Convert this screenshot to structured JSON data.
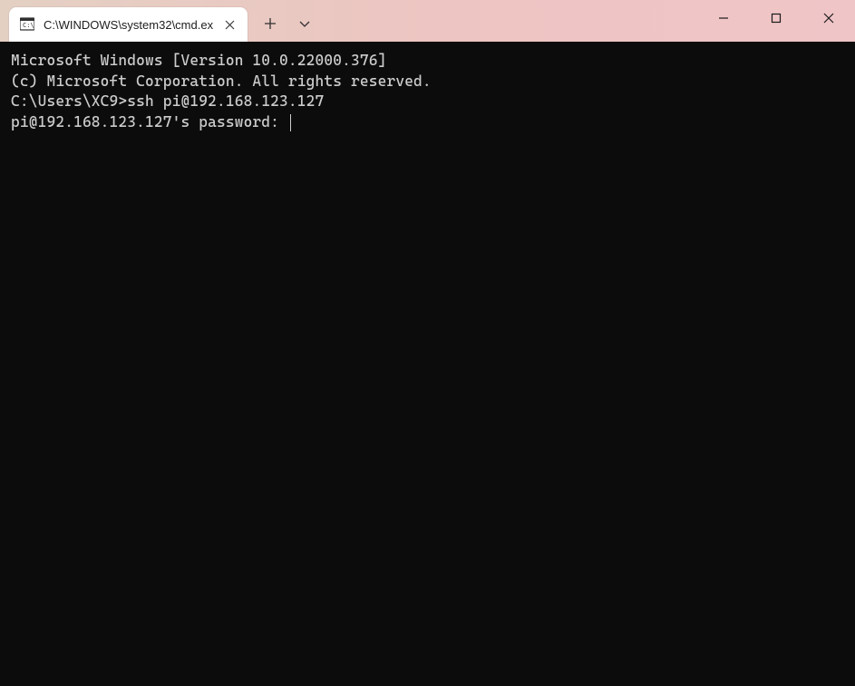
{
  "tab": {
    "title": "C:\\WINDOWS\\system32\\cmd.ex",
    "icon_name": "cmd-icon"
  },
  "terminal": {
    "line1": "Microsoft Windows [Version 10.0.22000.376]",
    "line2": "(c) Microsoft Corporation. All rights reserved.",
    "blank1": "",
    "prompt": "C:\\Users\\XC9>",
    "command": "ssh pi@192.168.123.127",
    "password_prompt": "pi@192.168.123.127's password: "
  }
}
